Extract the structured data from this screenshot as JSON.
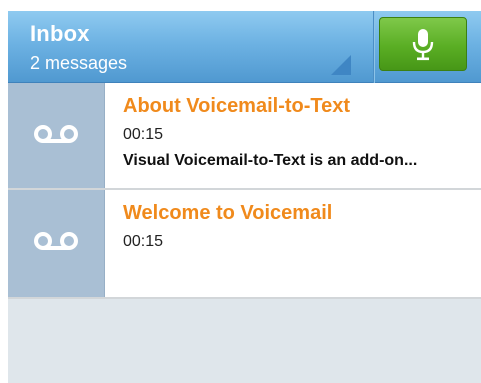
{
  "header": {
    "title": "Inbox",
    "subtitle": "2 messages",
    "voice_button_icon": "microphone-icon"
  },
  "messages": [
    {
      "icon": "voicemail-icon",
      "title": "About Voicemail-to-Text",
      "duration": "00:15",
      "preview": "Visual Voicemail-to-Text is an add-on..."
    },
    {
      "icon": "voicemail-icon",
      "title": "Welcome to Voicemail",
      "duration": "00:15",
      "preview": ""
    }
  ],
  "colors": {
    "header_blue": "#6db2e3",
    "title_orange": "#f08a1c",
    "voice_button_green": "#5aae24",
    "icon_cell_blue": "#a9bfd4"
  }
}
